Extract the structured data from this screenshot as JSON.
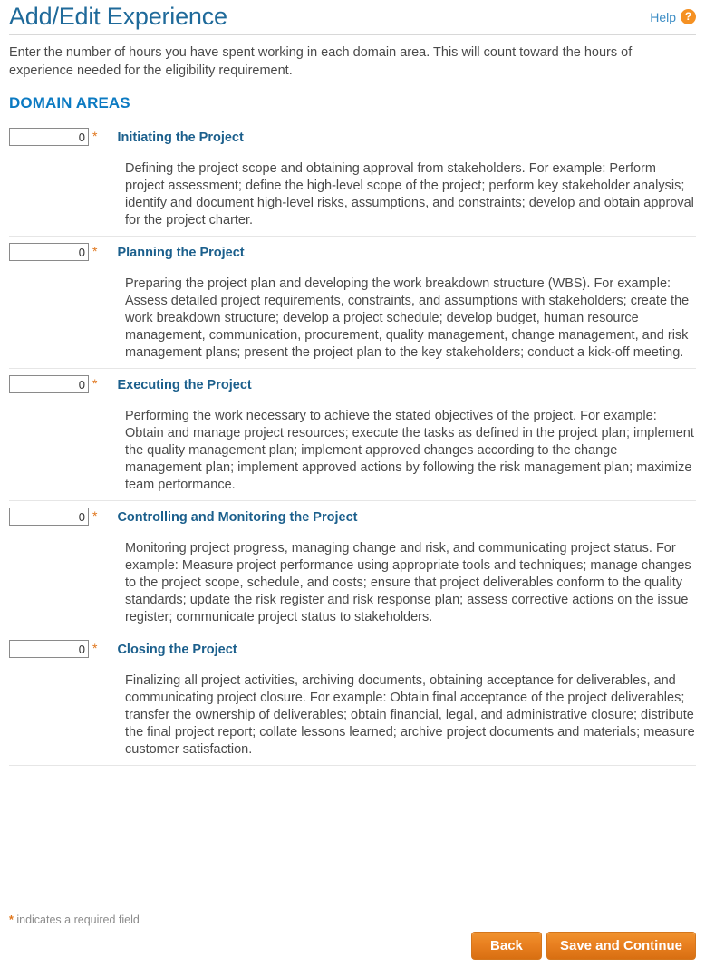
{
  "header": {
    "title": "Add/Edit Experience",
    "help_label": "Help",
    "help_icon": "question-circle-icon"
  },
  "intro": "Enter the number of hours you have spent working in each domain area. This will count toward the hours of experience needed for the eligibility requirement.",
  "section_heading": "DOMAIN AREAS",
  "domains": [
    {
      "value": "0",
      "placeholder": "",
      "required_marker": "*",
      "label": "Initiating the Project",
      "description": "Defining the project scope and obtaining approval from stakeholders. For example: Perform project assessment; define the high-level scope of the project; perform key stakeholder analysis; identify and document high-level risks, assumptions, and constraints; develop and obtain approval for the project charter."
    },
    {
      "value": "0",
      "placeholder": "",
      "required_marker": "*",
      "label": "Planning the Project",
      "description": "Preparing the project plan and developing the work breakdown structure (WBS). For example: Assess detailed project requirements, constraints, and assumptions with stakeholders; create the work breakdown structure; develop a project schedule; develop budget, human resource management, communication, procurement, quality management, change management, and risk management plans; present the project plan to the key stakeholders; conduct a kick-off meeting."
    },
    {
      "value": "0",
      "placeholder": "",
      "required_marker": "*",
      "label": "Executing the Project",
      "description": "Performing the work necessary to achieve the stated objectives of the project. For example: Obtain and manage project resources; execute the tasks as defined in the project plan; implement the quality management plan; implement approved changes according to the change management plan; implement approved actions by following the risk management plan; maximize team performance."
    },
    {
      "value": "0",
      "placeholder": "",
      "required_marker": "*",
      "label": "Controlling and Monitoring the Project",
      "description": "Monitoring project progress, managing change and risk, and communicating project status. For example: Measure project performance using appropriate tools and techniques; manage changes to the project scope, schedule, and costs; ensure that project deliverables conform to the quality standards; update the risk register and risk response plan; assess corrective actions on the issue register; communicate project status to stakeholders."
    },
    {
      "value": "0",
      "placeholder": "",
      "required_marker": "*",
      "label": "Closing the Project",
      "description": "Finalizing all project activities, archiving documents, obtaining acceptance for deliverables, and communicating project closure. For example: Obtain final acceptance of the project deliverables; transfer the ownership of deliverables; obtain financial, legal, and administrative closure; distribute the final project report; collate lessons learned; archive project documents and materials; measure customer satisfaction."
    }
  ],
  "footer": {
    "required_star": "*",
    "required_note": " indicates a required field",
    "back_label": "Back",
    "save_label": "Save and Continue"
  },
  "colors": {
    "title_blue": "#1f6a9a",
    "heading_blue": "#0b7ac2",
    "label_blue": "#1b5f8c",
    "accent_orange": "#e0761c",
    "button_orange": "#e98020",
    "link_blue": "#3c8dc5"
  }
}
